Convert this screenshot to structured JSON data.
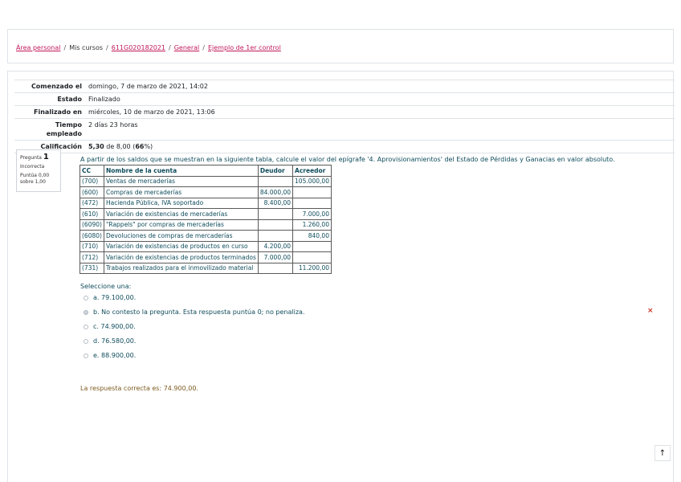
{
  "breadcrumb": [
    {
      "label": "Área personal",
      "link": true
    },
    {
      "label": "Mis cursos",
      "link": false
    },
    {
      "label": "611G020182021",
      "link": true
    },
    {
      "label": "General",
      "link": true
    },
    {
      "label": "Ejemplo de 1er control",
      "link": true
    }
  ],
  "breadcrumb_separator": "/",
  "summary": {
    "started_label": "Comenzado el",
    "started_value": "domingo, 7 de marzo de 2021, 14:02",
    "state_label": "Estado",
    "state_value": "Finalizado",
    "finished_label": "Finalizado en",
    "finished_value": "miércoles, 10 de marzo de 2021, 13:06",
    "time_label": "Tiempo empleado",
    "time_value": "2 días 23 horas",
    "grade_label": "Calificación",
    "grade_score": "5,30",
    "grade_rest": " de 8,00 (",
    "grade_pct": "66",
    "grade_end": "%)"
  },
  "question_info": {
    "label": "Pregunta",
    "number": "1",
    "status": "Incorrecta",
    "marks": "Puntúa 0,00 sobre 1,00"
  },
  "question_text": "A partir de los saldos que se muestran en la siguiente tabla, calcule el valor del epígrafe '4. Aprovisionamientos' del Estado de Pérdidas y Ganacias en valor absoluto.",
  "accounts_table": {
    "headers": [
      "CC",
      "Nombre de la cuenta",
      "Deudor",
      "Acreedor"
    ],
    "rows": [
      [
        "(700)",
        "Ventas de mercaderías",
        "",
        "105.000,00"
      ],
      [
        "(600)",
        "Compras de mercaderías",
        "84.000,00",
        ""
      ],
      [
        "(472)",
        "Hacienda Pública, IVA soportado",
        "8.400,00",
        ""
      ],
      [
        "(610)",
        "Variación de existencias de mercaderías",
        "",
        "7.000,00"
      ],
      [
        "(6090)",
        "\"Rappels\" por compras de mercaderías",
        "",
        "1.260,00"
      ],
      [
        "(6080)",
        "Devoluciones de compras de mercaderías",
        "",
        "840,00"
      ],
      [
        "(710)",
        "Variación de existencias de productos en curso",
        "4.200,00",
        ""
      ],
      [
        "(712)",
        "Variación de existencias de productos terminados",
        "7.000,00",
        ""
      ],
      [
        "(731)",
        "Trabajos realizados para el inmovilizado material",
        "",
        "11.200,00"
      ]
    ]
  },
  "answer_prompt": "Seleccione una:",
  "options": [
    {
      "label": "a. 79.100,00.",
      "checked": false
    },
    {
      "label": "b. No contesto la pregunta. Esta respuesta puntúa 0; no penaliza.",
      "checked": true
    },
    {
      "label": "c. 74.900,00.",
      "checked": false
    },
    {
      "label": "d. 76.580,00.",
      "checked": false
    },
    {
      "label": "e. 88.900,00.",
      "checked": false
    }
  ],
  "wrong_icon": "×",
  "feedback": "La respuesta correcta es: 74.900,00.",
  "back_to_top_icon": "↑",
  "colors": {
    "link": "#c2185b",
    "question_text": "#0f4c5c",
    "incorrect": "#ca3120",
    "feedback": "#7d5a1e"
  }
}
